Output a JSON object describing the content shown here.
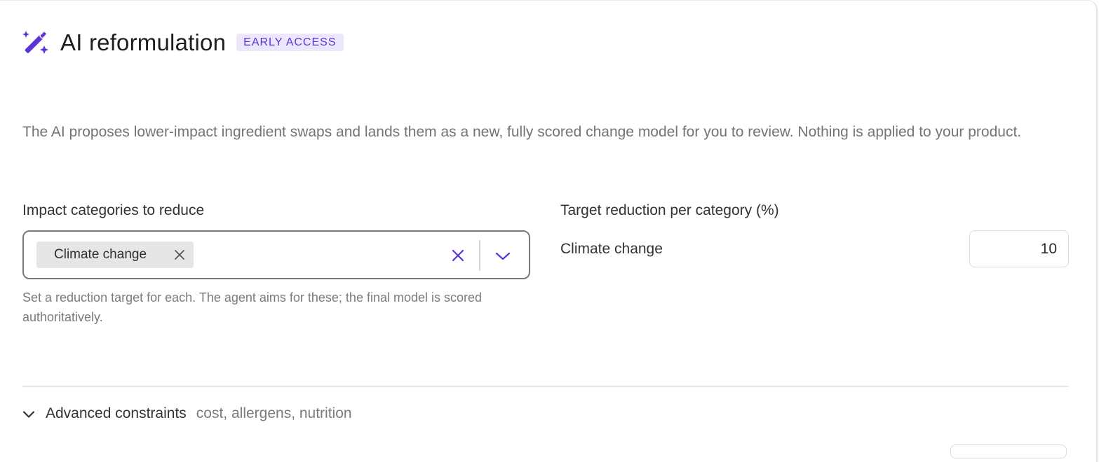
{
  "header": {
    "icon": "magic-wand-sparkles-icon",
    "title": "AI reformulation",
    "badge": "EARLY ACCESS"
  },
  "description": "The AI proposes lower-impact ingredient swaps and lands them as a new, fully scored change model for you to review. Nothing is applied to your product.",
  "impact_categories": {
    "label": "Impact categories to reduce",
    "selected": [
      {
        "label": "Climate change"
      }
    ],
    "help_text": "Set a reduction target for each. The agent aims for these; the final model is scored authoritatively."
  },
  "targets": {
    "label": "Target reduction per category (%)",
    "rows": [
      {
        "category": "Climate change",
        "value": "10"
      }
    ]
  },
  "advanced": {
    "title": "Advanced constraints",
    "hint": "cost, allergens, nutrition"
  },
  "colors": {
    "accent": "#5b33d9",
    "badge_bg": "#ece7fb",
    "chip_bg": "#e6e6e6"
  }
}
